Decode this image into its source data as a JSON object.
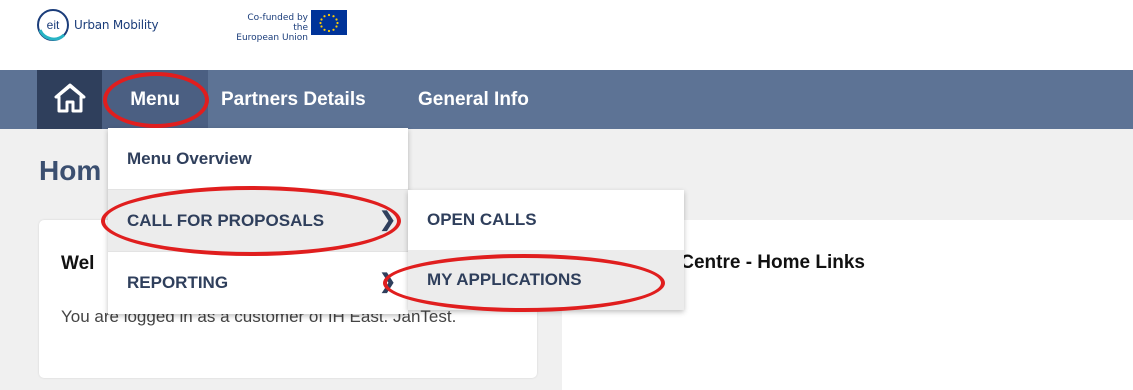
{
  "branding": {
    "eit_text": "eit",
    "name": "Urban Mobility",
    "cofunded_line1": "Co-funded by the",
    "cofunded_line2": "European Union"
  },
  "nav": {
    "home_icon": "home-icon",
    "items": [
      {
        "label": "Menu"
      },
      {
        "label": "Partners Details"
      },
      {
        "label": "General Info"
      }
    ]
  },
  "page": {
    "title": "Hom",
    "left_card": {
      "title": "Wel",
      "text": "You are logged in as a customer of IH East. JanTest."
    },
    "right_card": {
      "title": "er Centre - Home Links"
    }
  },
  "dropdown": {
    "items": [
      {
        "label": "Menu Overview"
      },
      {
        "label": "CALL FOR PROPOSALS",
        "chevron": "❯"
      },
      {
        "label": "REPORTING",
        "chevron": "❯"
      }
    ],
    "submenu": [
      {
        "label": "OPEN CALLS"
      },
      {
        "label": "MY APPLICATIONS"
      }
    ]
  },
  "colors": {
    "navbar": "#5d7395",
    "home_bg": "#2f3f5c",
    "annotation_red": "#e01e1e"
  }
}
